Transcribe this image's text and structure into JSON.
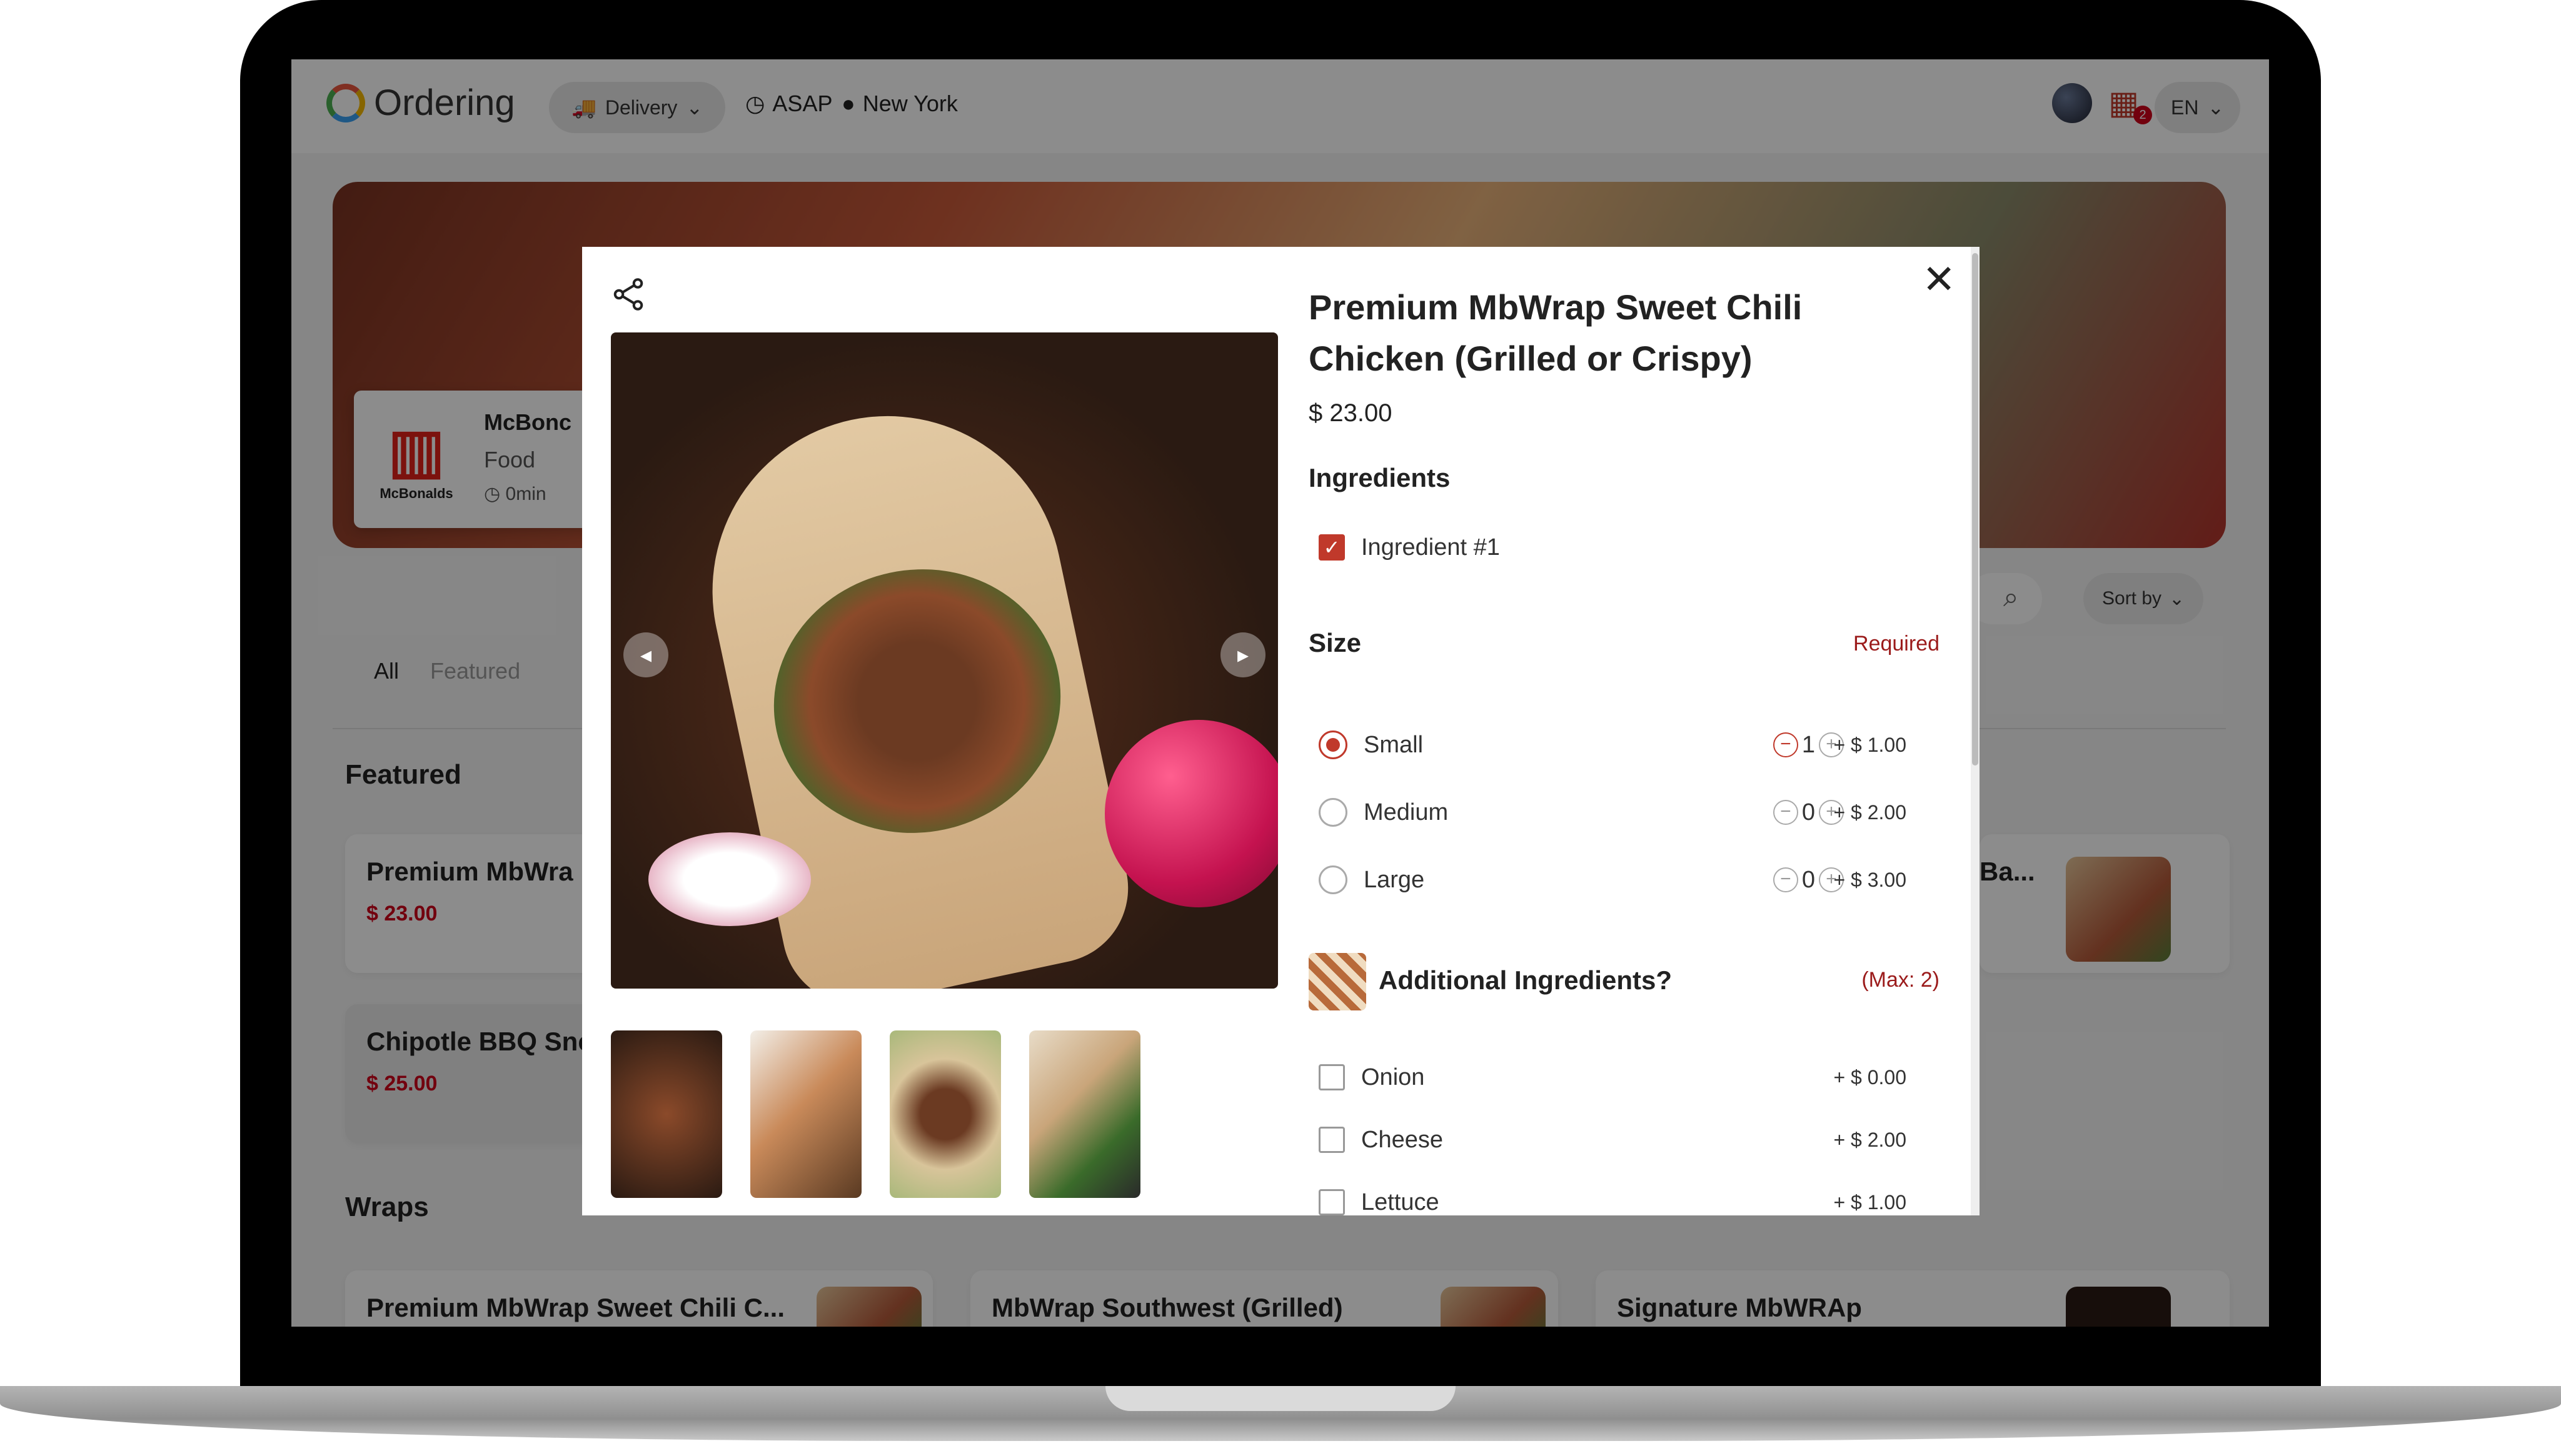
{
  "header": {
    "logo_text": "Ordering",
    "delivery_label": "Delivery",
    "time_label": "ASAP",
    "location_label": "New York",
    "cart_count": "2",
    "language": "EN"
  },
  "store": {
    "name": "McBonc",
    "type": "Food",
    "time": "0min",
    "logo_text": "McBonalds"
  },
  "toolbar": {
    "sort_label": "Sort by"
  },
  "categories": [
    "All",
    "Featured"
  ],
  "sections": {
    "featured": "Featured",
    "wraps": "Wraps"
  },
  "featured_products": [
    {
      "name": "Premium MbWra",
      "price": "$ 23.00"
    },
    {
      "name": "Chipotle BBQ Snc",
      "price": "$ 25.00"
    },
    {
      "name": "Ba...",
      "price": ""
    }
  ],
  "wrap_products": [
    {
      "name": "Premium MbWrap Sweet Chili C..."
    },
    {
      "name": "MbWrap Southwest (Grilled)"
    },
    {
      "name": "Signature MbWRAp"
    }
  ],
  "modal": {
    "title": "Premium MbWrap Sweet Chili Chicken (Grilled or Crispy)",
    "price": "$ 23.00",
    "ingredients_title": "Ingredients",
    "ingredients": [
      {
        "label": "Ingredient #1",
        "checked": true
      }
    ],
    "size_title": "Size",
    "size_required": "Required",
    "sizes": [
      {
        "label": "Small",
        "qty": "1",
        "price": "+ $ 1.00",
        "selected": true
      },
      {
        "label": "Medium",
        "qty": "0",
        "price": "+ $ 2.00",
        "selected": false
      },
      {
        "label": "Large",
        "qty": "0",
        "price": "+ $ 3.00",
        "selected": false
      }
    ],
    "additional_title": "Additional Ingredients?",
    "additional_max": "(Max: 2)",
    "additional": [
      {
        "label": "Onion",
        "price": "+ $ 0.00"
      },
      {
        "label": "Cheese",
        "price": "+ $ 2.00"
      },
      {
        "label": "Lettuce",
        "price": "+ $ 1.00"
      }
    ]
  },
  "colors": {
    "accent": "#c0392b",
    "price_red": "#d0021b"
  }
}
